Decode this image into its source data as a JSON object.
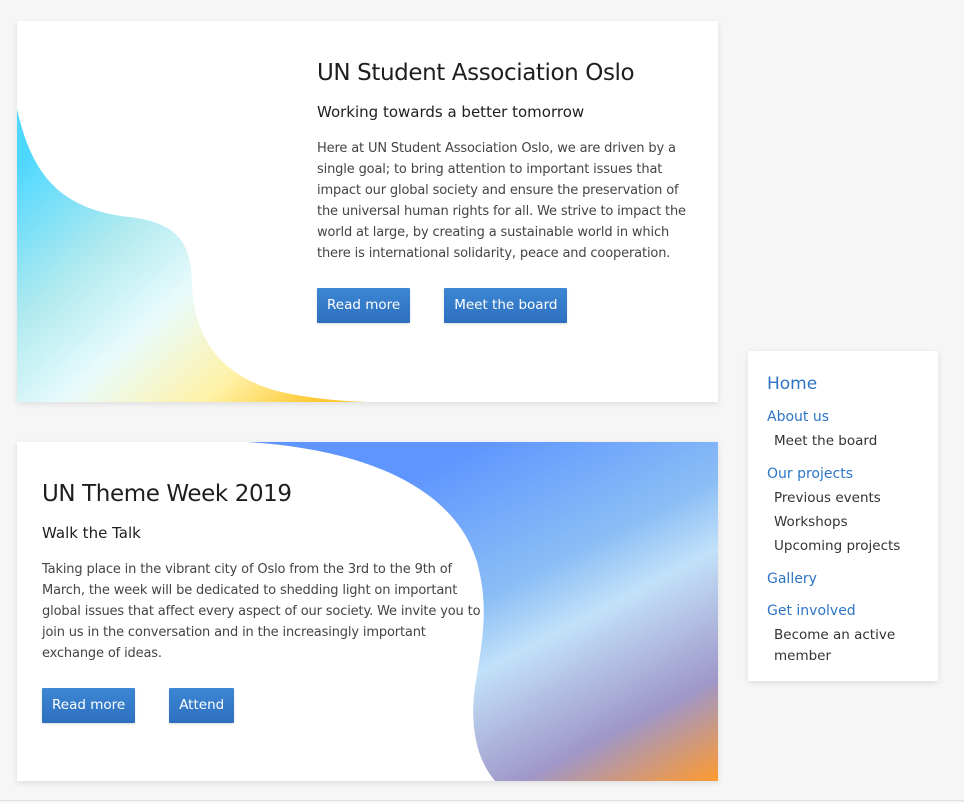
{
  "colors": {
    "accent": "#2d75c6",
    "button_top": "#3c87d3",
    "button_bottom": "#2e6fbf",
    "background": "#f6f6f6",
    "card": "#ffffff"
  },
  "card1": {
    "title": "UN Student Association Oslo",
    "subtitle": "Working towards a better tomorrow",
    "body": "Here at UN Student Association Oslo, we are driven by a single goal; to bring attention to important issues that impact our global society and ensure the preservation of the universal human rights for all. We strive to impact the world at large, by creating a sustainable world in which there is international solidarity, peace and cooperation.",
    "buttons": [
      "Read more",
      "Meet the board"
    ],
    "gradient": [
      "#4fd8ff",
      "#ade9ef",
      "#e8fbfc",
      "#fff2a8",
      "#ffc934"
    ]
  },
  "card2": {
    "title": "UN Theme Week 2019",
    "subtitle": "Walk the Talk",
    "body": "Taking place in the vibrant city of Oslo from the 3rd to the 9th of March, the week will be dedicated to shedding light on important global issues that affect every aspect of our society. We invite you to join us in the conversation and in the increasingly important exchange of ideas.",
    "buttons": [
      "Read more",
      "Attend"
    ],
    "gradient": [
      "#5f95ff",
      "#8bbef5",
      "#c2e1f9",
      "#9f97c8",
      "#ff9a2f"
    ]
  },
  "sidebar": {
    "home": "Home",
    "sections": [
      {
        "label": "About us",
        "items": [
          "Meet the board"
        ]
      },
      {
        "label": "Our projects",
        "items": [
          "Previous events",
          "Workshops",
          "Upcoming projects"
        ]
      },
      {
        "label": "Gallery",
        "items": []
      },
      {
        "label": "Get involved",
        "items": [
          "Become an active member"
        ]
      }
    ]
  }
}
